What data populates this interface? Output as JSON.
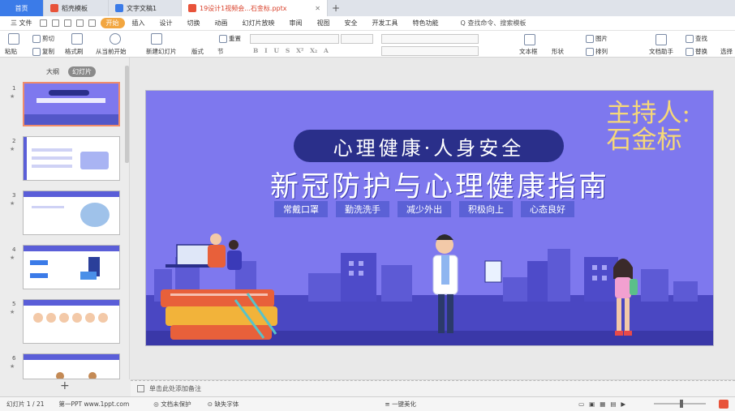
{
  "tabs": {
    "home": "首页",
    "t1": "稻壳模板",
    "t2": "文字文稿1",
    "t3": "19设计1视频会...石金标.pptx"
  },
  "menu": {
    "file": "三 文件",
    "items": [
      "开始",
      "插入",
      "设计",
      "切换",
      "动画",
      "幻灯片放映",
      "审阅",
      "视图",
      "安全",
      "开发工具",
      "特色功能"
    ],
    "search": "Q 查找命令、搜索模板"
  },
  "ribbon": {
    "cut": "剪切",
    "paste": "粘贴",
    "copy": "复制",
    "format_painter": "格式刷",
    "from_current": "从当前开始",
    "new_slide": "新建幻灯片",
    "layout": "版式",
    "section": "节",
    "reset": "重置",
    "textbox": "文本框",
    "shape": "形状",
    "arrange": "排列",
    "picture": "图片",
    "text_assist": "文档助手",
    "find": "查找",
    "replace": "替换",
    "select": "选择"
  },
  "view_tabs": {
    "outline": "大纲",
    "slides": "幻灯片"
  },
  "thumbnails": [
    "1",
    "2",
    "3",
    "4",
    "5",
    "6"
  ],
  "slide": {
    "host_line1": "主持人:",
    "host_line2": "石金标",
    "pill": "心理健康·人身安全",
    "title": "新冠防护与心理健康指南",
    "keywords": [
      "常戴口罩",
      "勤洗洗手",
      "减少外出",
      "积极向上",
      "心态良好"
    ]
  },
  "notes": {
    "placeholder": "单击此处添加备注"
  },
  "status": {
    "slide_count": "幻灯片 1 / 21",
    "theme": "第一PPT  www.1ppt.com",
    "protect": "文档未保护",
    "missing_font": "缺失字体",
    "beautify": "一键美化"
  },
  "colors": {
    "slide_bg": "#7e78ee",
    "accent_orange": "#f2a640",
    "host_gold": "#f6d878",
    "pill_navy": "#2a2f8a"
  }
}
